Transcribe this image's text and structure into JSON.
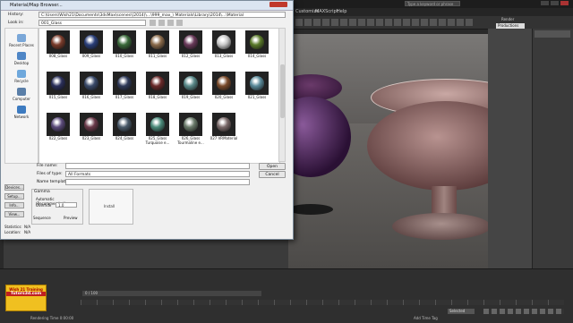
{
  "app": {
    "search_placeholder": "Type a keyword or phrase",
    "menus": [
      "Customize",
      "MAXScript",
      "Help"
    ],
    "menus_right": [
      "Perspective",
      "Print Studio",
      "Realtime"
    ],
    "production_label": "Productions",
    "render_label": "Render"
  },
  "dialog": {
    "title": "Material/Map Browser...",
    "history_label": "History:",
    "history_value": "C:\\Users\\Wish21\\Documents\\3dsMax\\scenes\\(2014)\\...\\999_max_\\ Materials\\Library\\2014\\...\\Material",
    "lookin_label": "Look in:",
    "lookin_value": "001_Glass",
    "places": [
      {
        "label": "Recent Places",
        "icon": "recent-icon",
        "color": "#7aa7d8"
      },
      {
        "label": "Desktop",
        "icon": "desktop-icon",
        "color": "#4f86c6"
      },
      {
        "label": "Recycle",
        "icon": "recycle-icon",
        "color": "#6fa8dc"
      },
      {
        "label": "Computer",
        "icon": "computer-icon",
        "color": "#5a7fa8"
      },
      {
        "label": "Network",
        "icon": "network-icon",
        "color": "#3d7bc0"
      }
    ],
    "files": [
      {
        "label": "008_Glass",
        "color": "#7a3b2a"
      },
      {
        "label": "009_Glass",
        "color": "#2a3f7a"
      },
      {
        "label": "010_Glass",
        "color": "#3b6a3b"
      },
      {
        "label": "011_Glass",
        "color": "#8a6a4a"
      },
      {
        "label": "012_Glass",
        "color": "#6a3a5a"
      },
      {
        "label": "013_Glass",
        "color": "#c8c8c8"
      },
      {
        "label": "014_Glass",
        "color": "#5a7a2a"
      },
      {
        "label": "015_Glass",
        "color": "#2a2f5a"
      },
      {
        "label": "016_Glass",
        "color": "#3a4a6a"
      },
      {
        "label": "017_Glass",
        "color": "#2f3a5a"
      },
      {
        "label": "018_Glass",
        "color": "#6a2a2a"
      },
      {
        "label": "019_Glass",
        "color": "#5a8a8a"
      },
      {
        "label": "020_Glass",
        "color": "#7a4a2a"
      },
      {
        "label": "021_Glass",
        "color": "#5a8a9a"
      },
      {
        "label": "022_Glass",
        "color": "#5a4a7a"
      },
      {
        "label": "023_Glass",
        "color": "#6a3a4a"
      },
      {
        "label": "024_Glass",
        "color": "#4a5a6a"
      },
      {
        "label": "025_Glass Turquoise e...",
        "color": "#4a8a7a"
      },
      {
        "label": "026_Glass Tourmaline e...",
        "color": "#6a7a6a"
      },
      {
        "label": "027 VRMaterial",
        "color": "#7a6a6a"
      }
    ],
    "filename_label": "File name:",
    "filename_value": "",
    "filetype_label": "Files of type:",
    "filetype_value": "All Formats",
    "nametemplate_label": "Name template:",
    "open_label": "Open",
    "cancel_label": "Cancel",
    "gamma_label": "Gamma",
    "automatic_label": "Automatic (Recommended)",
    "override_label": "Override",
    "override_value": "1.0",
    "sequence_label": "Sequence",
    "preview_label": "Preview",
    "preview_text": "Install",
    "left_buttons": [
      "Devices...",
      "Setup...",
      "Info...",
      "View..."
    ],
    "statistics_label": "Statistics:",
    "statistics_value": "N/A",
    "location_label": "Location:",
    "location_value": "N/A"
  },
  "timeline": {
    "frame_label": "0 / 100",
    "status": "Rendering Time 0:00:00",
    "logo_top": "Wish 21 Training",
    "logo_bottom": "Tutors3d.com",
    "selected": "Selected",
    "add_time_tag": "Add Time Tag"
  },
  "colors": {
    "dialog_bg": "#f0f0f0",
    "title_bg": "#dbe5f1",
    "viewport_bg": "#5d5a58",
    "accent": "#f0c020"
  }
}
